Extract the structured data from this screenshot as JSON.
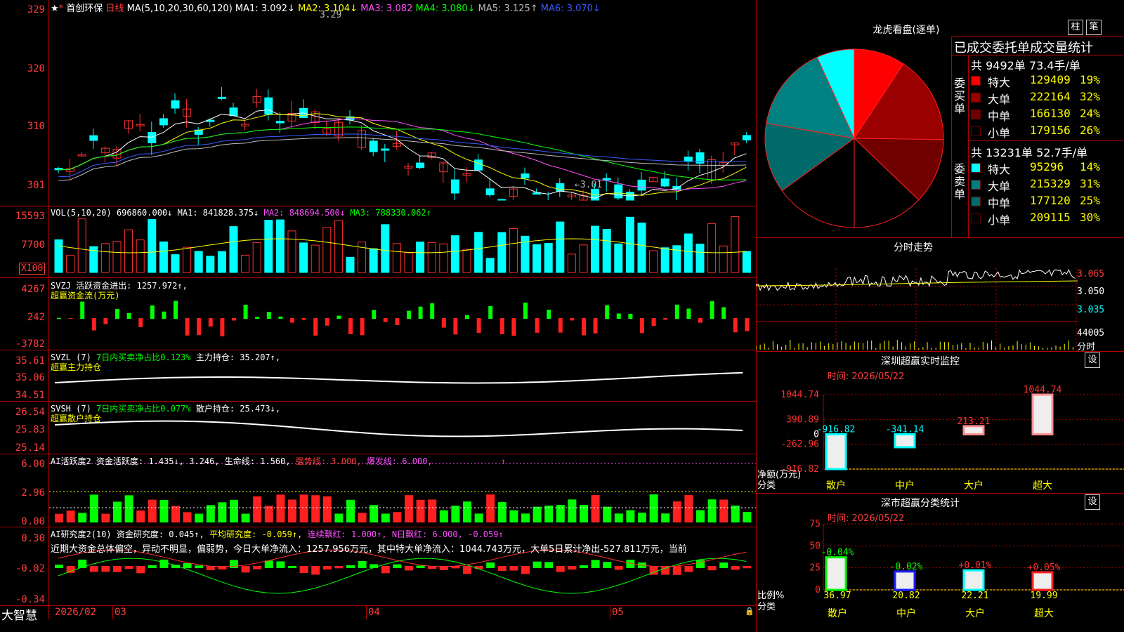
{
  "header": {
    "stock": "首创环保",
    "period": "日线",
    "ma_label": "MA(5,10,20,30,60,120)",
    "ma1": "MA1: 3.092↓",
    "ma2": "MA2: 3.104↓",
    "ma3": "MA3: 3.082",
    "ma4": "MA4: 3.080↓",
    "ma5": "MA5: 3.125↑",
    "ma6": "MA6: 3.070↓",
    "high_marker": "3.29",
    "low_marker": "←3.01"
  },
  "price_axis": [
    "329",
    "320",
    "310",
    "301"
  ],
  "vol": {
    "label": "VOL(5,10,20)",
    "value": "696860.000↓",
    "ma1": "MA1: 841828.375↓",
    "ma2": "MA2: 848694.500↓",
    "ma3": "MA3: 788330.062↑",
    "axis": [
      "15593",
      "7700"
    ],
    "unit": "X100"
  },
  "svzj": {
    "line1": "SVZJ  活跃资金进出: 1257.972↑,",
    "line2": "超赢资金流(万元)",
    "axis": [
      "4267",
      "242",
      "-3782"
    ]
  },
  "svzl": {
    "label": "SVZL (7)",
    "desc": "7日内买卖净占比0.123%",
    "hold": "主力持仓: 35.207↑,",
    "line2": "超赢主力持仓",
    "axis": [
      "35.61",
      "35.06",
      "34.51"
    ]
  },
  "svsh": {
    "label": "SVSH (7)",
    "desc": "7日内买卖净占比0.077%",
    "hold": "散户持仓: 25.473↓,",
    "line2": "超赢散户持仓",
    "axis": [
      "26.54",
      "25.83",
      "25.14"
    ]
  },
  "ai1": {
    "label": "AI活跃度2",
    "act": "资金活跃度: 1.435↓, 3.246,",
    "life": "生命线: 1.560,",
    "strong": "强势线: 3.000,",
    "burst": "爆发线: 6.000,",
    "arrow": "↑",
    "axis": [
      "6.00",
      "2.96",
      "0.00"
    ]
  },
  "ai2": {
    "label": "AI研究度2(10)",
    "res": "资金研究度: 0.045↑,",
    "avg": "平均研究度: -0.059↑,",
    "cont": "连续飘红: 1.000↑,",
    "nday": "N日飘红: 6.000,",
    "last": "-0.059↑",
    "comment": "近期大资金总体偏空，异动不明显，偏弱势，今日大单净流入：1257.956万元，其中特大单净流入：1044.743万元，大单5日累计净出-527.811万元，当前",
    "axis": [
      "0.30",
      "-0.02",
      "-0.34"
    ]
  },
  "date_axis": {
    "brand": "大智慧",
    "d1": "2026/02",
    "d2": "03",
    "d3": "04",
    "d4": "05"
  },
  "dragon": {
    "title": "龙虎看盘(逐单)",
    "btn1": "柱",
    "btn2": "笔",
    "subtitle": "已成交委托单成交量统计",
    "buy_label": "委买单",
    "buy_total": "共 9492单 73.4手/单",
    "buy_rows": [
      {
        "name": "特大",
        "val": "129409",
        "pct": "19%",
        "color": "#ff0000"
      },
      {
        "name": "大单",
        "val": "222164",
        "pct": "32%",
        "color": "#9a0000"
      },
      {
        "name": "中单",
        "val": "166130",
        "pct": "24%",
        "color": "#700000"
      },
      {
        "name": "小单",
        "val": "179156",
        "pct": "26%",
        "color": "#000000"
      }
    ],
    "sell_label": "委卖单",
    "sell_total": "共 13231单 52.7手/单",
    "sell_rows": [
      {
        "name": "特大",
        "val": "95296",
        "pct": "14%",
        "color": "#00ffff"
      },
      {
        "name": "大单",
        "val": "215329",
        "pct": "31%",
        "color": "#008080"
      },
      {
        "name": "中单",
        "val": "177120",
        "pct": "25%",
        "color": "#006a6a"
      },
      {
        "name": "小单",
        "val": "209115",
        "pct": "30%",
        "color": "#000000"
      }
    ]
  },
  "timeshare": {
    "title": "分时走势",
    "axis": [
      "3.065",
      "3.050",
      "3.035"
    ],
    "vol": "44005",
    "unit": "分时"
  },
  "monitor": {
    "title": "深圳超赢实时监控",
    "btn": "设",
    "time": "时间: 2026/05/22",
    "axis": [
      "1044.74",
      "390.89",
      "-262.96",
      "-916.82"
    ],
    "axis_title1": "净额(万元)",
    "axis_title2": "分类",
    "bars": [
      {
        "cat": "散户",
        "value": "-916.82"
      },
      {
        "cat": "中户",
        "value": "-341.14"
      },
      {
        "cat": "大户",
        "value": "213.21"
      },
      {
        "cat": "超大",
        "value": "1044.74"
      }
    ]
  },
  "classify": {
    "title": "深市超赢分类统计",
    "btn": "设",
    "time": "时间: 2026/05/22",
    "axis": [
      "75",
      "50",
      "25",
      "0"
    ],
    "axis_title1": "比例%",
    "axis_title2": "分类",
    "bars": [
      {
        "cat": "散户",
        "value": "36.97",
        "delta": "-0.04%"
      },
      {
        "cat": "中户",
        "value": "20.82",
        "delta": "-0.02%"
      },
      {
        "cat": "大户",
        "value": "22.21",
        "delta": "+0.01%"
      },
      {
        "cat": "超大",
        "value": "19.99",
        "delta": "+0.05%"
      }
    ]
  },
  "colors": {
    "up": "#ff3030",
    "down": "#00ffff",
    "grid": "#b00000"
  }
}
